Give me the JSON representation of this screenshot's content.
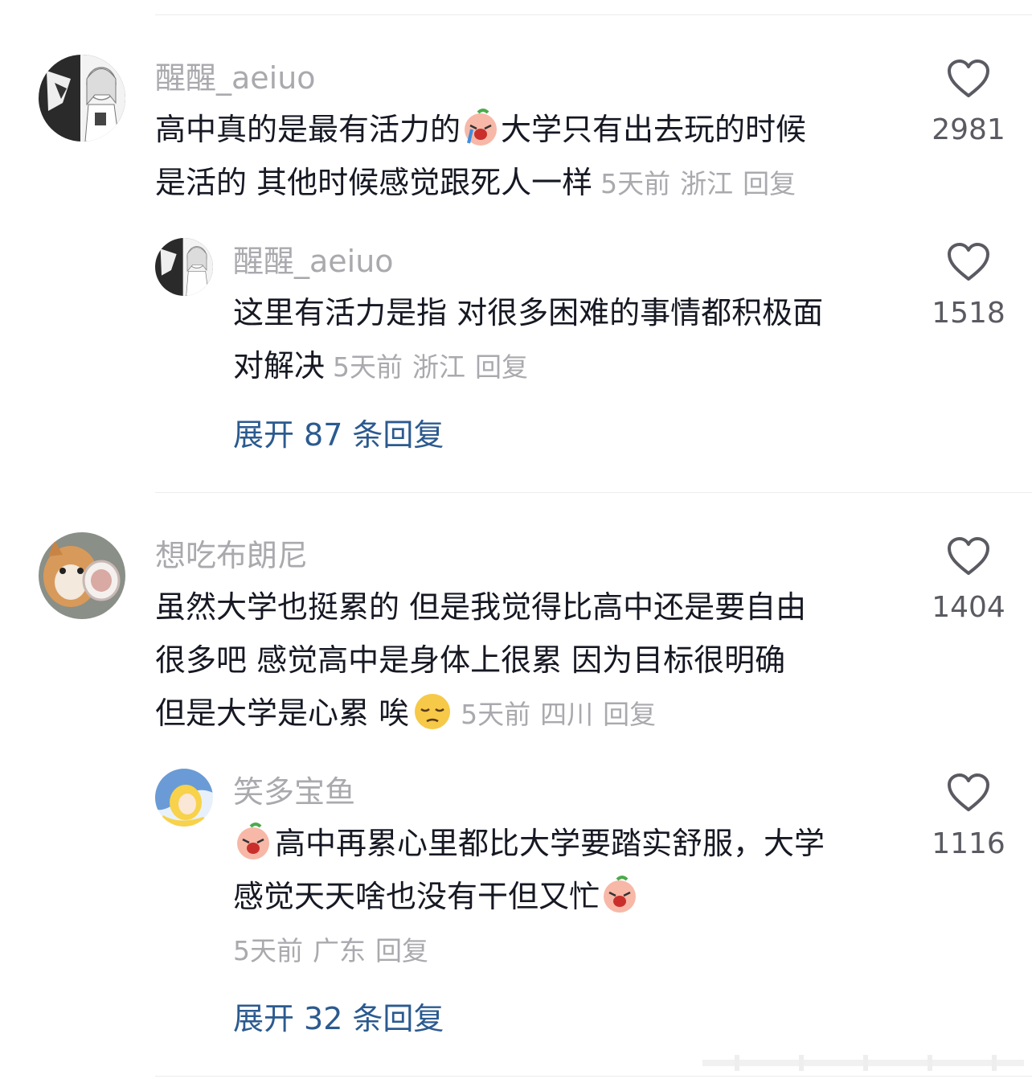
{
  "comments": [
    {
      "username": "醒醒_aeiuo",
      "text_lines": [
        "高中真的是最有活力的",
        "大学只有出去玩的时候",
        "是活的 其他时候感觉跟死人一样"
      ],
      "emoji": "crying-face-emoji",
      "time": "5天前",
      "location": "浙江",
      "reply_label": "回复",
      "likes": "2981",
      "replies": [
        {
          "username": "醒醒_aeiuo",
          "text_lines": [
            "这里有活力是指 对很多困难的事情都积极面",
            "对解决"
          ],
          "time": "5天前",
          "location": "浙江",
          "reply_label": "回复",
          "likes": "1518"
        }
      ],
      "expand": {
        "prefix": "展开",
        "count": "87",
        "suffix": "条回复"
      }
    },
    {
      "username": "想吃布朗尼",
      "text_lines": [
        "虽然大学也挺累的 但是我觉得比高中还是要自由",
        "很多吧 感觉高中是身体上很累 因为目标很明确",
        "但是大学是心累 唉"
      ],
      "emoji": "pensive-face-emoji",
      "time": "5天前",
      "location": "四川",
      "reply_label": "回复",
      "likes": "1404",
      "replies": [
        {
          "username": "笑多宝鱼",
          "text_lines": [
            "高中再累心里都比大学要踏实舒服，大学",
            "感觉天天啥也没有干但又忙"
          ],
          "emoji": "crying-face-emoji",
          "time": "5天前",
          "location": "广东",
          "reply_label": "回复",
          "likes": "1116"
        }
      ],
      "expand": {
        "prefix": "展开",
        "count": "32",
        "suffix": "条回复"
      }
    }
  ],
  "colors": {
    "text": "#161823",
    "meta": "#a9a9ae",
    "link": "#2b5a8f",
    "likes": "#5a5a62"
  }
}
